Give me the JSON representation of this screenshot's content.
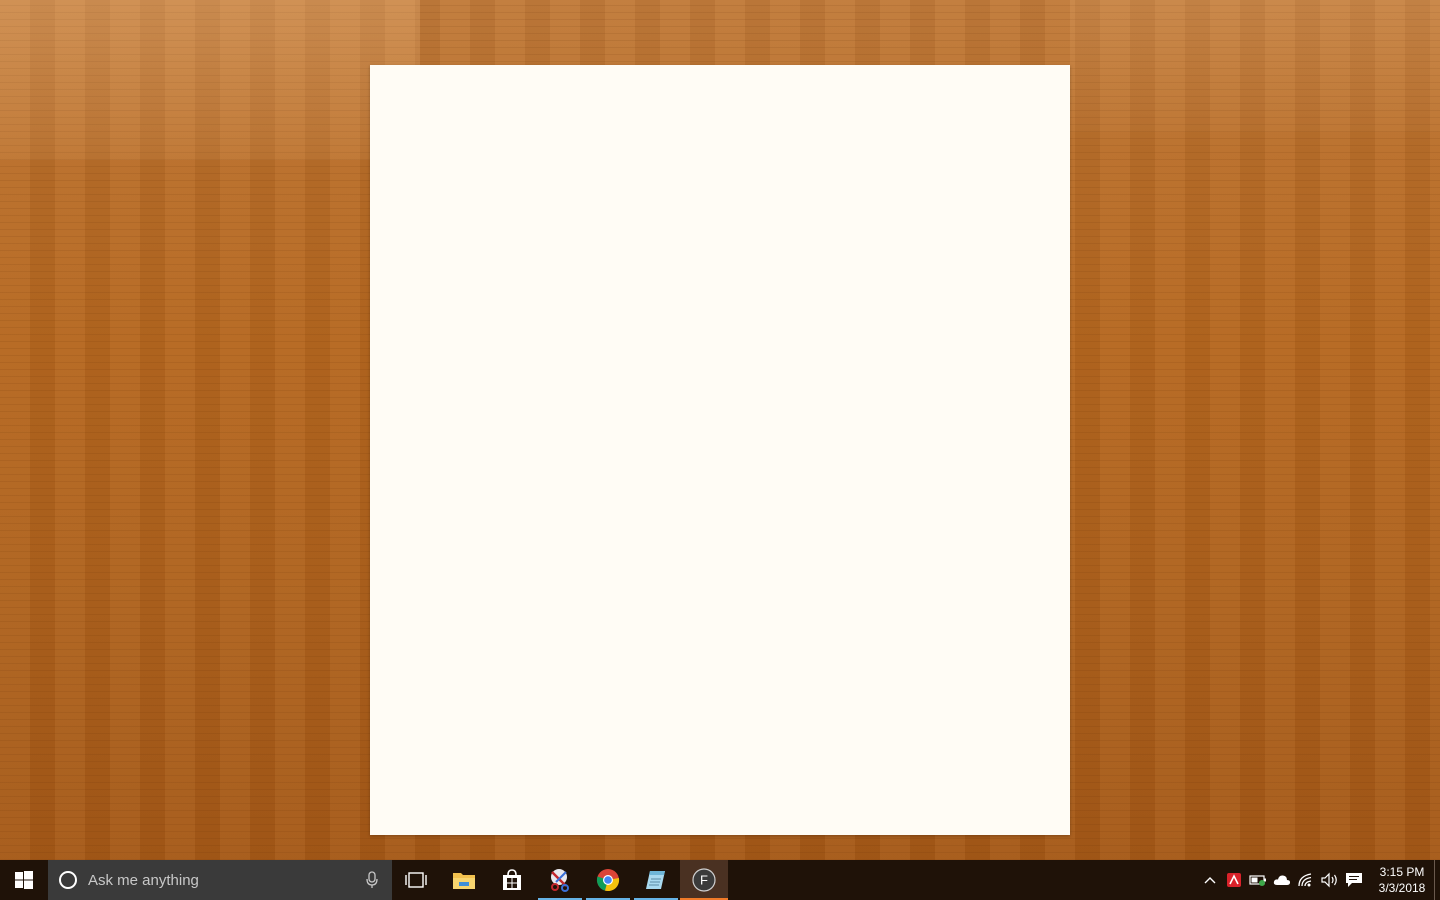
{
  "taskbar": {
    "search_placeholder": "Ask me anything",
    "pinned": [
      {
        "name": "task-view",
        "icon": "task-view-icon"
      },
      {
        "name": "file-explorer",
        "icon": "folder-icon"
      },
      {
        "name": "store",
        "icon": "store-icon"
      },
      {
        "name": "snipping-tool",
        "icon": "scissors-icon",
        "running": true
      },
      {
        "name": "chrome",
        "icon": "chrome-icon",
        "running": true
      },
      {
        "name": "notepad",
        "icon": "notepad-icon",
        "running": true
      },
      {
        "name": "app-f",
        "icon": "f-circle-icon",
        "running": true,
        "active": true
      }
    ],
    "tray": {
      "clock_time": "3:15 PM",
      "clock_date": "3/3/2018"
    }
  },
  "colors": {
    "taskbar_bg": "#1f1208",
    "active_indicator": "#f07a28",
    "running_indicator": "#66b3e6",
    "paper": "#fffcf5"
  }
}
